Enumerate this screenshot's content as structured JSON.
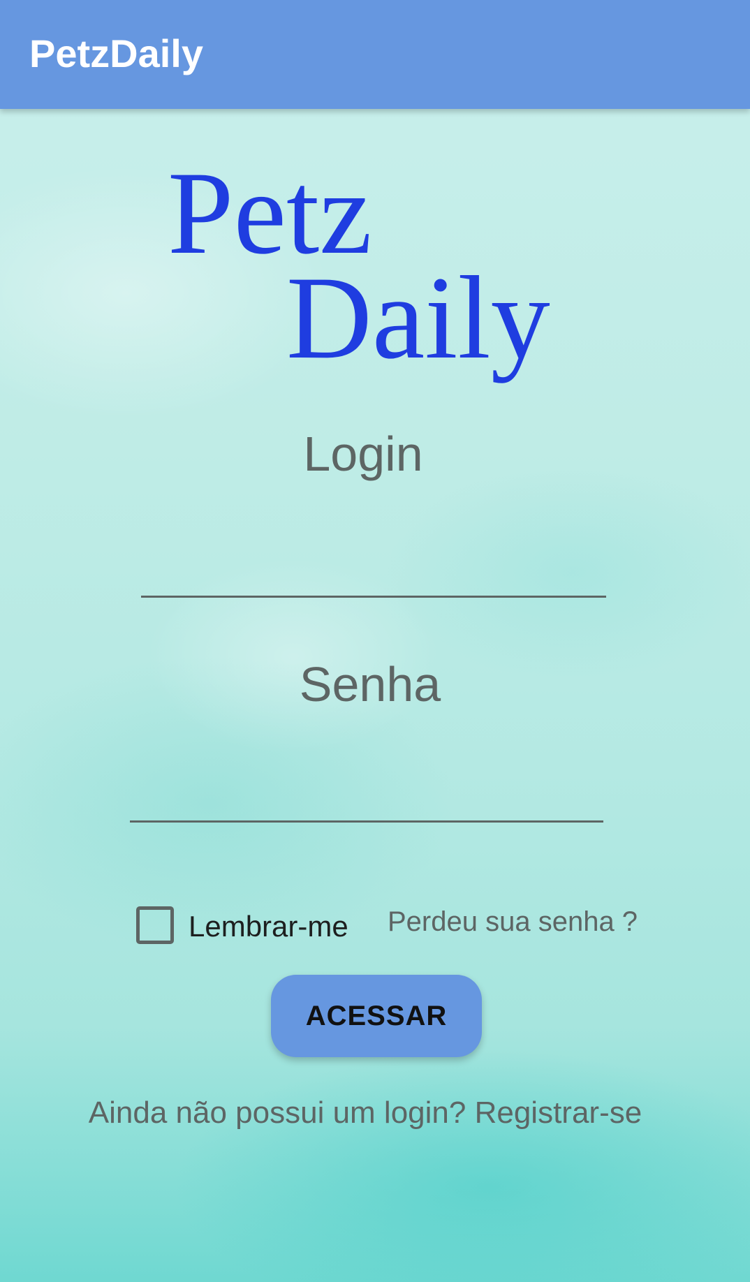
{
  "app_bar": {
    "title": "PetzDaily",
    "background_color": "#6697e0"
  },
  "logo": {
    "line1": "Petz",
    "line2": "Daily",
    "color": "#1f3de0"
  },
  "login_field": {
    "label": "Login",
    "value": ""
  },
  "password_field": {
    "label": "Senha",
    "value": ""
  },
  "remember_me": {
    "label": "Lembrar-me",
    "checked": false
  },
  "forgot_password": {
    "label": "Perdeu sua senha ?"
  },
  "access_button": {
    "label": "ACESSAR"
  },
  "register": {
    "prompt": "Ainda não possui um login?",
    "link_label": "Registrar-se"
  }
}
